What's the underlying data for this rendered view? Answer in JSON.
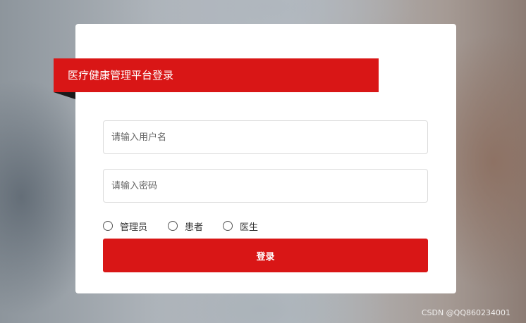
{
  "login": {
    "title": "医疗健康管理平台登录",
    "username_placeholder": "请输入用户名",
    "password_placeholder": "请输入密码",
    "roles": [
      "管理员",
      "患者",
      "医生"
    ],
    "submit_label": "登录"
  },
  "watermark": "CSDN @QQ860234001",
  "colors": {
    "accent": "#d91616",
    "card": "#ffffff",
    "fold": "#1a1a1a"
  }
}
